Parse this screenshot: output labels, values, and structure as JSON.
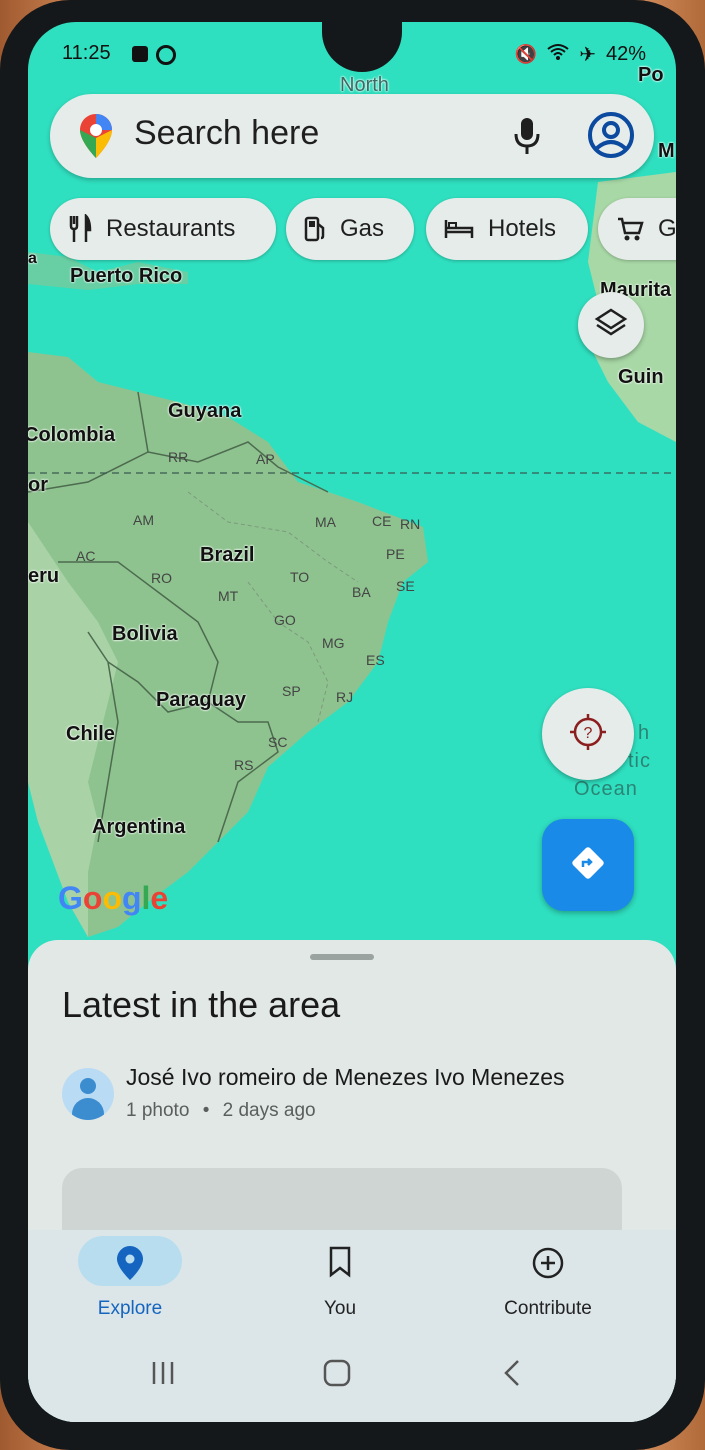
{
  "status_bar": {
    "time": "11:25",
    "battery": "42%"
  },
  "search": {
    "placeholder": "Search here"
  },
  "chips": [
    {
      "label": "Restaurants",
      "icon": "fork-knife-icon"
    },
    {
      "label": "Gas",
      "icon": "gas-pump-icon"
    },
    {
      "label": "Hotels",
      "icon": "bed-icon"
    },
    {
      "label": "G",
      "icon": "cart-icon"
    }
  ],
  "map": {
    "labels": {
      "north": "North",
      "po": "Po",
      "m": "M",
      "puerto_rico": "Puerto Rico",
      "mauritania": "Maurita",
      "guinea": "Guin",
      "guyana": "Guyana",
      "colombia": "Colombia",
      "ecuador": "or",
      "brazil": "Brazil",
      "peru": "eru",
      "bolivia": "Bolivia",
      "paraguay": "Paraguay",
      "chile": "Chile",
      "argentina": "Argentina",
      "ocean_h": "h",
      "ocean_tic": "tic",
      "ocean": "Ocean",
      "a": "a"
    },
    "states": [
      "RR",
      "AP",
      "AM",
      "MA",
      "CE",
      "RN",
      "AC",
      "PE",
      "RO",
      "TO",
      "MT",
      "BA",
      "SE",
      "GO",
      "MG",
      "ES",
      "SP",
      "RJ",
      "SC",
      "RS"
    ],
    "attribution": "Google"
  },
  "sheet": {
    "title": "Latest in the area",
    "post": {
      "author": "José Ivo romeiro de Menezes Ivo Menezes",
      "photos": "1 photo",
      "separator": "•",
      "time": "2 days ago"
    }
  },
  "nav": {
    "items": [
      {
        "label": "Explore",
        "icon": "pin-icon",
        "active": true
      },
      {
        "label": "You",
        "icon": "bookmark-icon",
        "active": false
      },
      {
        "label": "Contribute",
        "icon": "plus-circle-icon",
        "active": false
      }
    ]
  },
  "colors": {
    "water": "#2fe0c0",
    "land": "#8ec38f",
    "accent": "#1a8ae8"
  }
}
